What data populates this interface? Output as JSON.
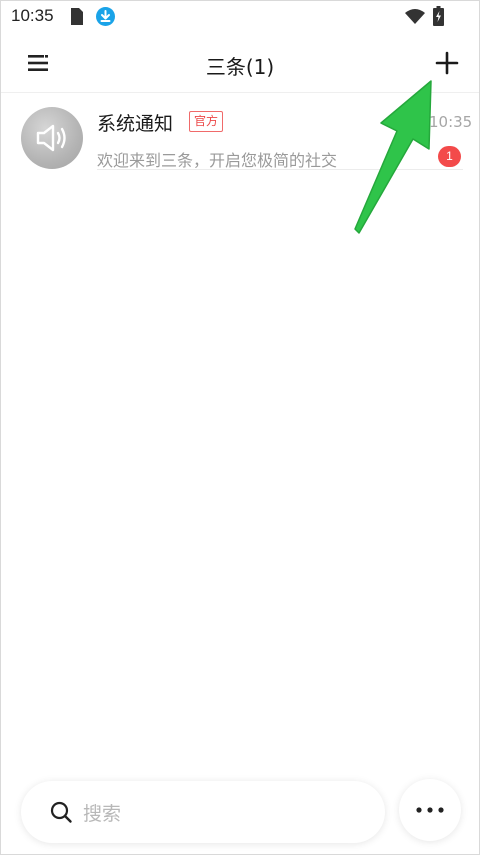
{
  "status_bar": {
    "time": "10:35",
    "icons": [
      "sim-card-icon",
      "download-icon",
      "wifi-icon",
      "battery-icon"
    ],
    "download_color": "#1aa3e8"
  },
  "header": {
    "title": "三条(1)",
    "left_icon": "menu-icon",
    "right_icon": "add-icon"
  },
  "conversations": [
    {
      "name": "系统通知",
      "badge": "官方",
      "time": "10:35",
      "preview": "欢迎来到三条，开启您极简的社交",
      "unread": "1",
      "avatar_icon": "speaker-icon"
    }
  ],
  "search": {
    "placeholder": "搜索"
  },
  "more_button": {
    "icon": "more-dots-icon"
  },
  "colors": {
    "accent_red": "#f34a4a",
    "arrow_green": "#2fc44a"
  }
}
